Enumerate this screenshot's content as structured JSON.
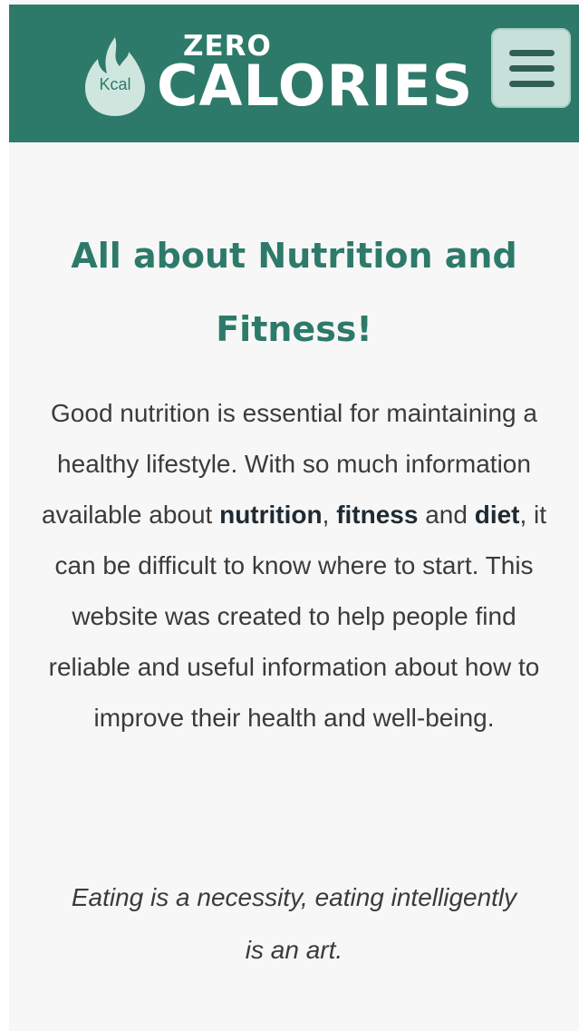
{
  "header": {
    "logo": {
      "kcal": "Kcal",
      "zero": "ZERO",
      "calories": "CALORIES"
    },
    "menu_icon": "hamburger-menu-icon"
  },
  "content": {
    "heading": "All about Nutrition and Fitness!",
    "intro": {
      "part1": "Good nutrition is essential for maintaining a healthy lifestyle. With so much information available about ",
      "bold1": "nutrition",
      "sep1": ", ",
      "bold2": "fitness",
      "sep2": " and ",
      "bold3": "diet",
      "part2": ", it can be difficult to know where to start. This website was created to help people find reliable and useful information about how to improve their health and well-being."
    },
    "quote": "Eating is a necessity, eating intelligently is an art."
  },
  "colors": {
    "brand": "#2e7a6a",
    "menu_button_bg": "#c7e1da",
    "page_bg": "#f7f7f7",
    "text": "#3b3b3b"
  }
}
